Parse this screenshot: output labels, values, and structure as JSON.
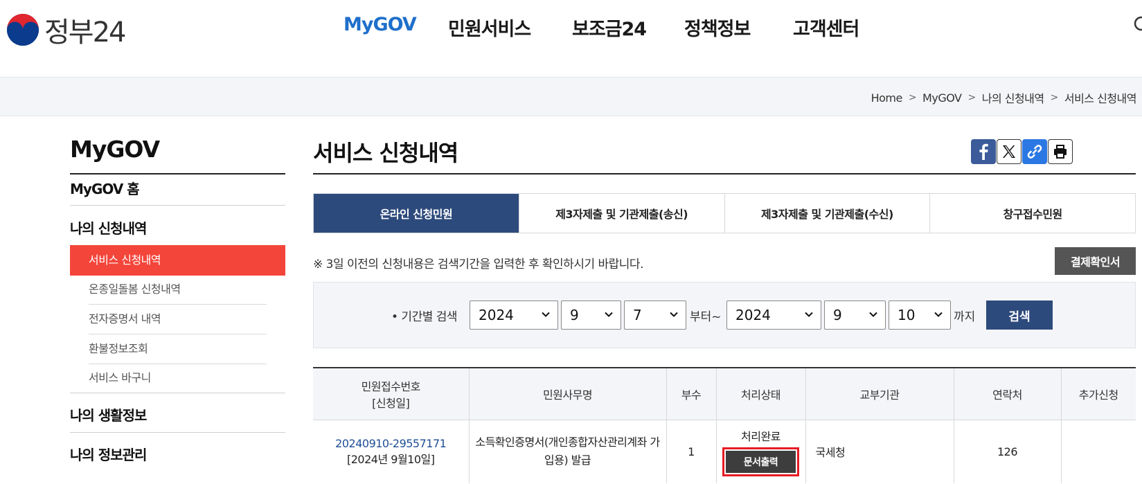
{
  "header": {
    "logo_text": "정부24",
    "nav": [
      "MyGOV",
      "민원서비스",
      "보조금24",
      "정책정보",
      "고객센터"
    ]
  },
  "breadcrumb": [
    "Home",
    "MyGOV",
    "나의 신청내역",
    "서비스 신청내역"
  ],
  "sidebar": {
    "title": "MyGOV",
    "home": "MyGOV 홈",
    "section1": "나의 신청내역",
    "sub_items": [
      "서비스 신청내역",
      "온종일돌봄 신청내역",
      "전자증명서 내역",
      "환불정보조회",
      "서비스 바구니"
    ],
    "section2": "나의 생활정보",
    "section3": "나의 정보관리"
  },
  "page": {
    "title": "서비스 신청내역",
    "tabs": [
      "온라인 신청민원",
      "제3자제출 및 기관제출(송신)",
      "제3자제출 및 기관제출(수신)",
      "창구접수민원"
    ],
    "notice": "※ 3일 이전의 신청내용은 검색기간을 입력한 후 확인하시기 바랍니다.",
    "pay_button": "결제확인서"
  },
  "search": {
    "label": "• 기간별 검색",
    "from_year": "2024",
    "from_month": "9",
    "from_day": "7",
    "from_suffix": "부터~",
    "to_year": "2024",
    "to_month": "9",
    "to_day": "10",
    "to_suffix": "까지",
    "button": "검색"
  },
  "table": {
    "headers": {
      "receipt_line1": "민원접수번호",
      "receipt_line2": "[신청일]",
      "name": "민원사무명",
      "copies": "부수",
      "status": "처리상태",
      "agency": "교부기관",
      "contact": "연락처",
      "extra": "추가신청"
    },
    "row": {
      "receipt_no": "20240910-29557171",
      "date": "[2024년 9월10일]",
      "name_line1": "소득확인증명서(개인종합자산관리계좌 가",
      "name_line2": "입용) 발급",
      "copies": "1",
      "status": "처리완료",
      "print_button": "문서출력",
      "agency": "국세청",
      "contact": "126",
      "extra": ""
    }
  },
  "colors": {
    "accent_blue": "#1f6fcb",
    "tab_active": "#2d4a7c",
    "sidebar_active": "#f4453a",
    "highlight_border": "#e51b24"
  }
}
